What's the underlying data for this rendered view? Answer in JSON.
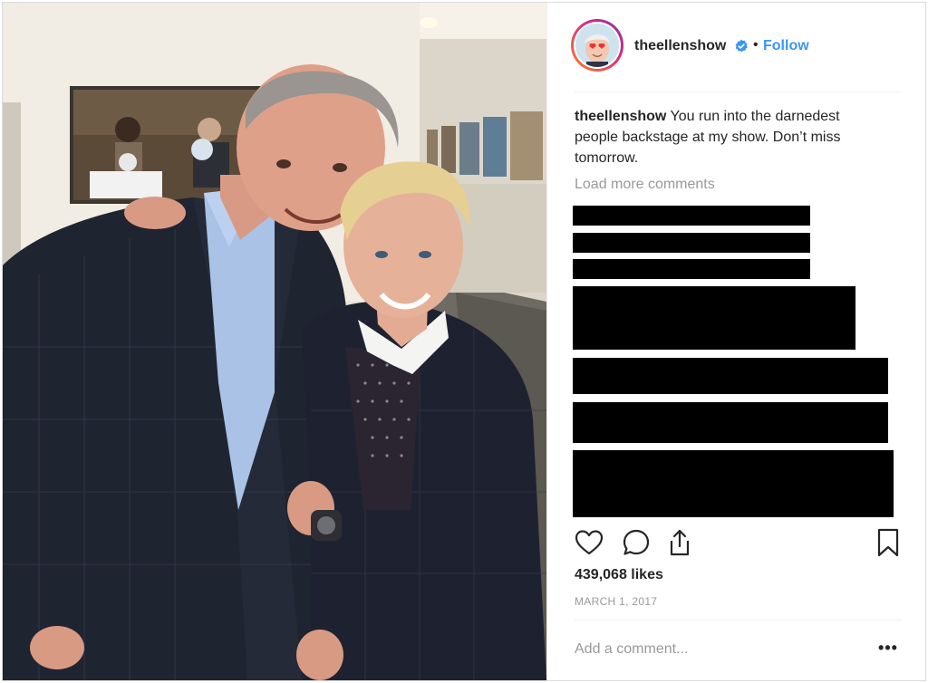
{
  "post": {
    "photo": {
      "icon": "photo-backstage-portrait"
    },
    "header": {
      "username": "theellenshow",
      "verified_icon": "verified-badge-icon",
      "separator": "•",
      "follow_label": "Follow",
      "accent_color": "#3897f0"
    },
    "caption": {
      "username": "theellenshow",
      "text": "You run into the darnedest people backstage at my show. Don’t miss tomorrow."
    },
    "comments": {
      "load_more_label": "Load more comments",
      "redacted_count": 7
    },
    "actions": {
      "like_icon": "heart-icon",
      "comment_icon": "comment-bubble-icon",
      "share_icon": "share-icon",
      "save_icon": "bookmark-icon"
    },
    "likes_label": "439,068 likes",
    "date_label": "MARCH 1, 2017",
    "add_comment": {
      "placeholder": "Add a comment...",
      "more_label": "•••"
    }
  }
}
